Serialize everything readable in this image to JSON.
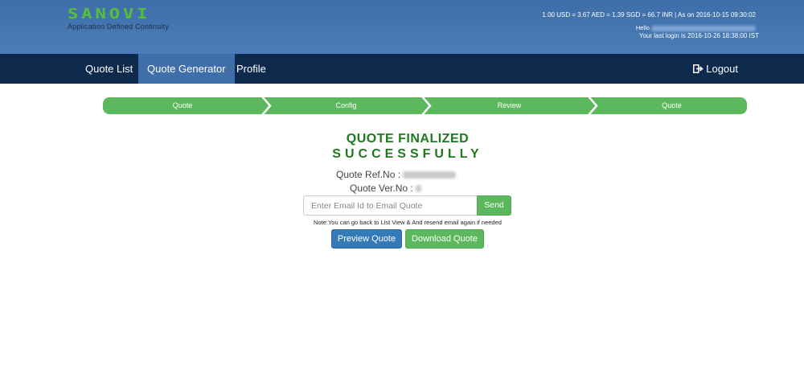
{
  "header": {
    "logo_text": "SANOVI",
    "tagline": "Application Defined Continuity",
    "exchange_rate": "1.00 USD = 3.67 AED = 1.39 SGD = 66.7 INR | As on 2016-10-15 09:30:02",
    "hello_label": "Hello",
    "last_login": "Your last login is 2016-10-26 18:38:00 IST"
  },
  "nav": {
    "items": [
      {
        "label": "Quote List"
      },
      {
        "label": "Quote Generator",
        "active": true
      },
      {
        "label": "Profile"
      }
    ],
    "logout_icon": "logout-icon",
    "logout_label": "Logout"
  },
  "steps": [
    {
      "label": "Quote"
    },
    {
      "label": "Config"
    },
    {
      "label": "Review"
    },
    {
      "label": "Quote"
    }
  ],
  "main": {
    "title_line1": "QUOTE FINALIZED",
    "title_line2": "SUCCESSFULLY",
    "ref_label": "Quote Ref.No :",
    "ver_label": "Quote Ver.No :",
    "email_placeholder": "Enter Email Id to Email Quote",
    "email_value": "",
    "send_label": "Send",
    "note": "Note:You can go back to List View & And resend email again if needed",
    "preview_label": "Preview Quote",
    "download_label": "Download Quote"
  },
  "colors": {
    "header_bg": "#4a7db8",
    "nav_bg": "#0d2a4d",
    "nav_active": "#3f6ea8",
    "step_green": "#5cb85c",
    "success_text": "#1d7a1d",
    "primary_button": "#337ab7"
  }
}
